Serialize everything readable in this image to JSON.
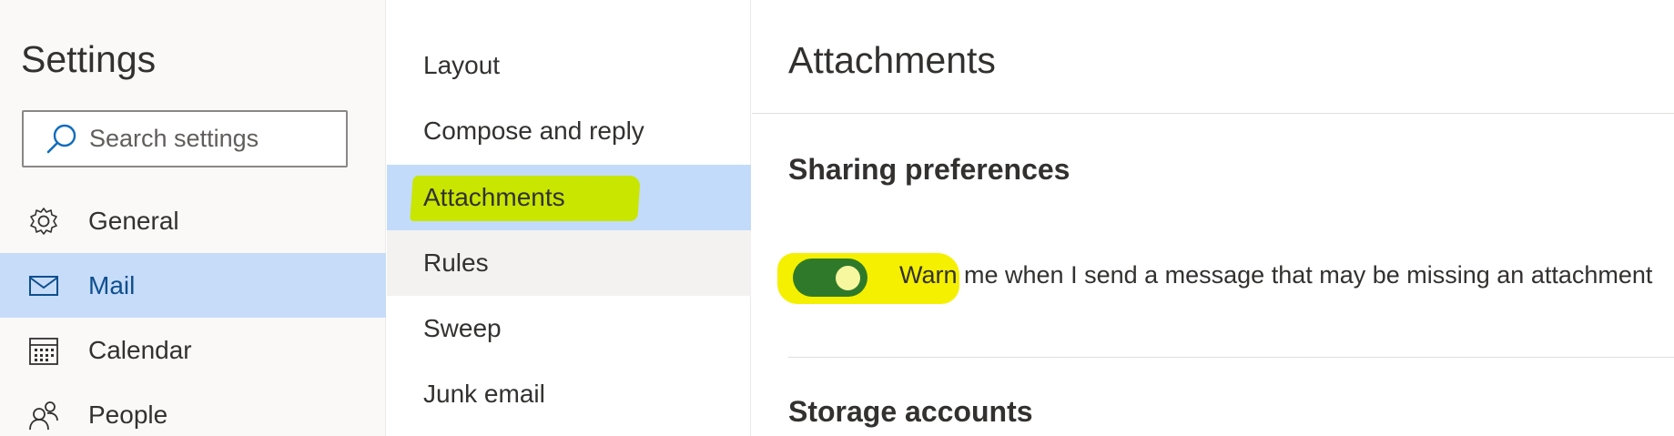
{
  "settings": {
    "title": "Settings",
    "search_placeholder": "Search settings"
  },
  "nav": [
    {
      "label": "General",
      "icon": "gear-icon",
      "selected": false
    },
    {
      "label": "Mail",
      "icon": "mail-icon",
      "selected": true
    },
    {
      "label": "Calendar",
      "icon": "calendar-icon",
      "selected": false
    },
    {
      "label": "People",
      "icon": "people-icon",
      "selected": false
    }
  ],
  "mail_menu": [
    {
      "label": "Layout"
    },
    {
      "label": "Compose and reply"
    },
    {
      "label": "Attachments",
      "selected": true
    },
    {
      "label": "Rules",
      "hovered": true
    },
    {
      "label": "Sweep"
    },
    {
      "label": "Junk email"
    }
  ],
  "attachments": {
    "title": "Attachments",
    "sharing_title": "Sharing preferences",
    "warn_toggle": {
      "label": "Warn me when I send a message that may be missing an attachment",
      "on": true
    },
    "storage_title": "Storage accounts"
  },
  "colors": {
    "selection": "#c7dcf9",
    "highlight_green": "#c8e600",
    "highlight_yellow": "#f5f000",
    "toggle_on": "#2f7a2a"
  }
}
